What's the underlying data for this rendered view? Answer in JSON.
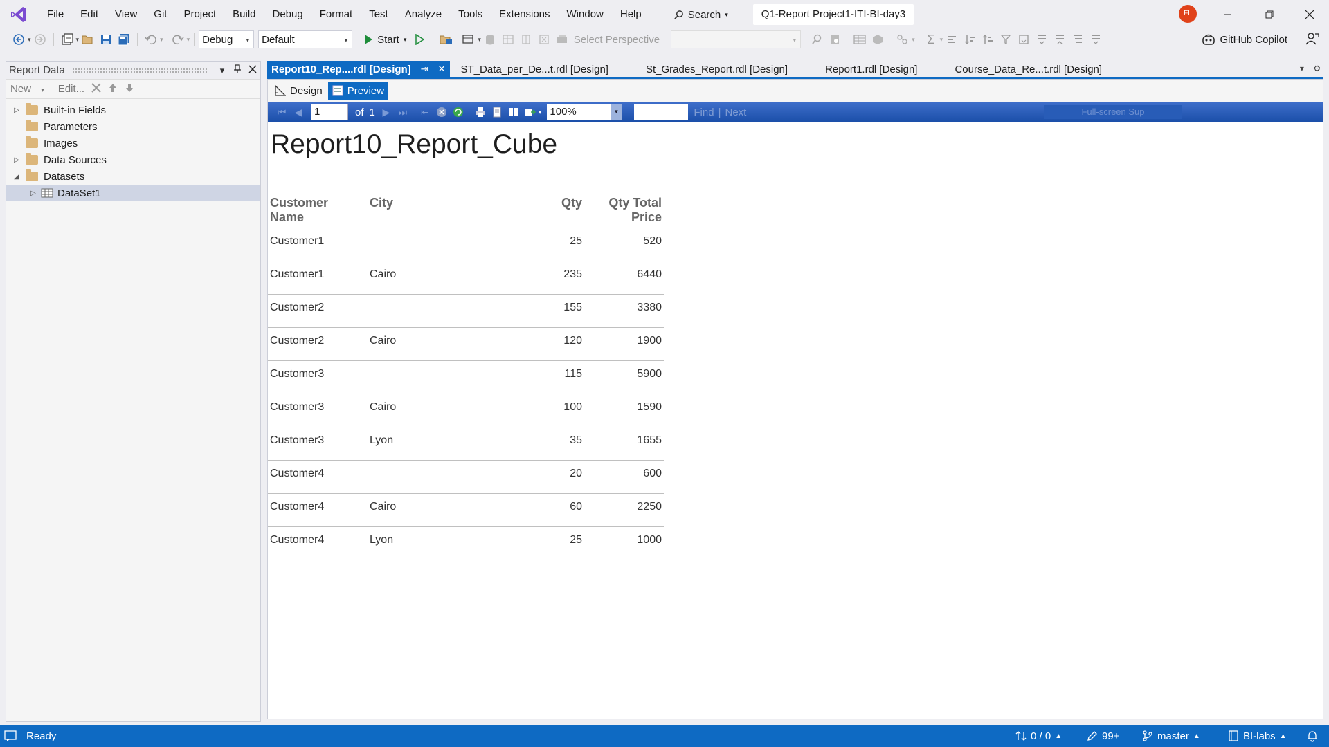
{
  "menubar": {
    "items": [
      "File",
      "Edit",
      "View",
      "Git",
      "Project",
      "Build",
      "Debug",
      "Format",
      "Test",
      "Analyze",
      "Tools",
      "Extensions",
      "Window",
      "Help"
    ],
    "search_label": "Search",
    "solution_name": "Q1-Report Project1-ITI-BI-day3",
    "avatar_initials": "FL"
  },
  "toolbar": {
    "config": "Debug",
    "platform": "Default",
    "start_label": "Start",
    "perspective_label": "Select Perspective",
    "copilot_label": "GitHub Copilot"
  },
  "report_data_panel": {
    "title": "Report Data",
    "new_label": "New",
    "edit_label": "Edit...",
    "tree": [
      {
        "label": "Built-in Fields",
        "expander": "collapsed"
      },
      {
        "label": "Parameters",
        "expander": "none"
      },
      {
        "label": "Images",
        "expander": "none"
      },
      {
        "label": "Data Sources",
        "expander": "collapsed"
      },
      {
        "label": "Datasets",
        "expander": "expanded"
      }
    ],
    "dataset_child": "DataSet1"
  },
  "doc_tabs": {
    "active": "Report10_Rep....rdl [Design]",
    "others": [
      "ST_Data_per_De...t.rdl [Design]",
      "St_Grades_Report.rdl [Design]",
      "Report1.rdl [Design]",
      "Course_Data_Re...t.rdl [Design]"
    ]
  },
  "mode_tabs": {
    "design": "Design",
    "preview": "Preview"
  },
  "report_toolbar": {
    "page_current": "1",
    "page_of": "of",
    "page_total": "1",
    "zoom": "100%",
    "find": "Find",
    "next": "Next",
    "fullscreen": "Full-screen Sup"
  },
  "report": {
    "title": "Report10_Report_Cube",
    "columns": [
      {
        "label": "Customer\nName",
        "align": "left"
      },
      {
        "label": "City",
        "align": "left"
      },
      {
        "label": "Qty",
        "align": "right"
      },
      {
        "label": "Qty Total Price",
        "align": "right"
      }
    ],
    "rows": [
      [
        "Customer1",
        "",
        "25",
        "520"
      ],
      [
        "Customer1",
        "Cairo",
        "235",
        "6440"
      ],
      [
        "Customer2",
        "",
        "155",
        "3380"
      ],
      [
        "Customer2",
        "Cairo",
        "120",
        "1900"
      ],
      [
        "Customer3",
        "",
        "115",
        "5900"
      ],
      [
        "Customer3",
        "Cairo",
        "100",
        "1590"
      ],
      [
        "Customer3",
        "Lyon",
        "35",
        "1655"
      ],
      [
        "Customer4",
        "",
        "20",
        "600"
      ],
      [
        "Customer4",
        "Cairo",
        "60",
        "2250"
      ],
      [
        "Customer4",
        "Lyon",
        "25",
        "1000"
      ]
    ]
  },
  "statusbar": {
    "ready": "Ready",
    "changes": "0 / 0",
    "edits": "99+",
    "branch": "master",
    "repo": "BI-labs"
  },
  "colors": {
    "accent": "#0e6ac3",
    "vs_purple": "#7b4bd1",
    "folder": "#dcb67a"
  }
}
